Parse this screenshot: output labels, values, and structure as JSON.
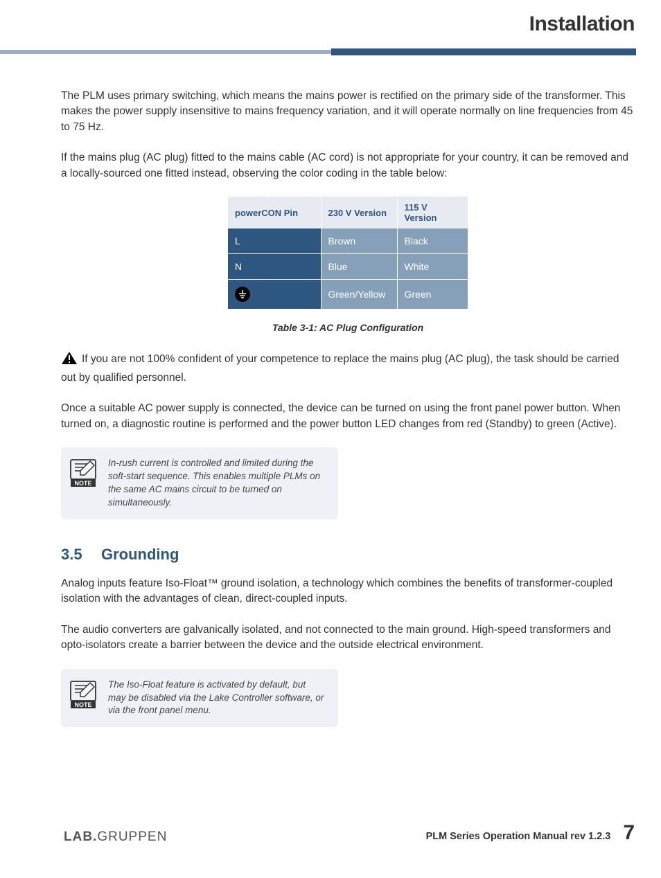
{
  "header": {
    "title": "Installation"
  },
  "body": {
    "p1": "The PLM uses primary switching, which means the mains power is rectified on the primary side of the transformer. This makes the power supply insensitive to mains frequency variation, and it will operate normally on line frequencies from 45 to 75 Hz.",
    "p2": "If the mains plug (AC plug) fitted to the mains cable (AC cord) is not appropriate for your country, it can be removed and a locally-sourced one fitted instead, observing the color coding in the table below:",
    "table": {
      "headers": [
        "powerCON Pin",
        "230 V Version",
        "115 V Version"
      ],
      "rows": [
        {
          "pin": "L",
          "v230": "Brown",
          "v115": "Black"
        },
        {
          "pin": "N",
          "v230": "Blue",
          "v115": "White"
        },
        {
          "pin": "GROUND_ICON",
          "v230": "Green/Yellow",
          "v115": "Green"
        }
      ],
      "caption": "Table 3-1: AC Plug Configuration"
    },
    "warning": "If you are not 100% confident of your competence to replace the mains plug (AC plug), the task should be carried out by qualified personnel.",
    "p3": "Once a suitable AC power supply is connected, the device can be turned on using the front panel power button. When turned on, a diagnostic routine is performed and the power button LED changes from red (Standby) to green (Active).",
    "note1": "In-rush current is controlled and limited during the soft-start sequence. This enables multiple PLMs on the same AC mains circuit to be turned on simultaneously.",
    "section": {
      "num": "3.5",
      "title": "Grounding"
    },
    "p4": "Analog inputs feature Iso-Float™ ground isolation, a technology which combines the benefits of transformer-coupled isolation with the advantages of clean, direct-coupled inputs.",
    "p5": "The audio converters are galvanically isolated, and not connected to the main ground. High-speed transformers and opto-isolators create a barrier between the device and the outside electrical environment.",
    "note2": "The Iso-Float feature is activated by default, but may be disabled via the Lake Controller software, or via the front panel menu."
  },
  "footer": {
    "logo_bold": "LAB.",
    "logo_light": "GRUPPEN",
    "text": "PLM Series Operation Manual  rev 1.2.3",
    "page": "7"
  }
}
